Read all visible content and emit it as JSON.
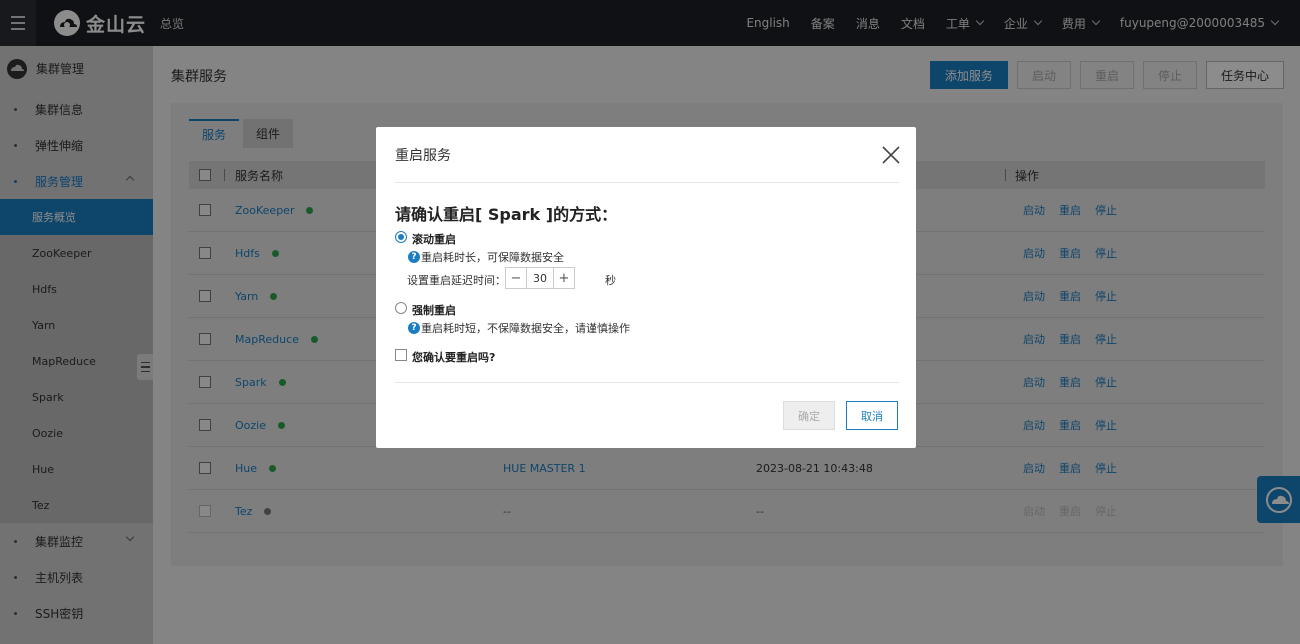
{
  "topbar": {
    "logo_text": "金山云",
    "overview": "总览",
    "nav": [
      {
        "label": "English",
        "dropdown": false
      },
      {
        "label": "备案",
        "dropdown": false
      },
      {
        "label": "消息",
        "dropdown": false
      },
      {
        "label": "文档",
        "dropdown": false
      },
      {
        "label": "工单",
        "dropdown": true
      },
      {
        "label": "企业",
        "dropdown": true
      },
      {
        "label": "费用",
        "dropdown": true
      },
      {
        "label": "fuyupeng@2000003485",
        "dropdown": true
      }
    ]
  },
  "sidebar": {
    "header": "集群管理",
    "items": [
      {
        "label": "集群信息"
      },
      {
        "label": "弹性伸缩"
      },
      {
        "label": "服务管理"
      },
      {
        "label": "集群监控"
      },
      {
        "label": "主机列表"
      },
      {
        "label": "SSH密钥"
      }
    ],
    "sub_items": [
      {
        "label": "服务概览"
      },
      {
        "label": "ZooKeeper"
      },
      {
        "label": "Hdfs"
      },
      {
        "label": "Yarn"
      },
      {
        "label": "MapReduce"
      },
      {
        "label": "Spark"
      },
      {
        "label": "Oozie"
      },
      {
        "label": "Hue"
      },
      {
        "label": "Tez"
      }
    ]
  },
  "main": {
    "title": "集群服务",
    "buttons": {
      "add": "添加服务",
      "start": "启动",
      "restart": "重启",
      "stop": "停止",
      "tasks": "任务中心"
    },
    "tabs": [
      {
        "label": "服务"
      },
      {
        "label": "组件"
      }
    ],
    "table": {
      "col_name": "服务名称",
      "col_ops": "操作",
      "ops_labels": {
        "start": "启动",
        "restart": "重启",
        "stop": "停止"
      },
      "rows": [
        {
          "name": "ZooKeeper",
          "status_color": "#2ea44f",
          "col3": "",
          "col4": ""
        },
        {
          "name": "Hdfs",
          "status_color": "#2ea44f",
          "col3": "",
          "col4": ""
        },
        {
          "name": "Yarn",
          "status_color": "#2ea44f",
          "col3": "",
          "col4": ""
        },
        {
          "name": "MapReduce",
          "status_color": "#2ea44f",
          "col3": "",
          "col4": ""
        },
        {
          "name": "Spark",
          "status_color": "#2ea44f",
          "col3": "",
          "col4": ""
        },
        {
          "name": "Oozie",
          "status_color": "#2ea44f",
          "col3": "",
          "col4": ""
        },
        {
          "name": "Hue",
          "status_color": "#2ea44f",
          "col3": "HUE MASTER 1",
          "col4": "2023-08-21 10:43:48"
        },
        {
          "name": "Tez",
          "status_color": "#777777",
          "col3": "--",
          "col4": "--"
        }
      ]
    }
  },
  "modal": {
    "title": "重启服务",
    "question": "请确认重启[ Spark ]的方式：",
    "option_rolling": {
      "label": "滚动重启",
      "hint": "重启耗时长，可保障数据安全",
      "selected": true
    },
    "delay": {
      "label": "设置重启延迟时间：",
      "value": "30",
      "unit": "秒",
      "minus": "−",
      "plus": "+"
    },
    "option_force": {
      "label": "强制重启",
      "hint": "重启耗时短，不保障数据安全，请谨慎操作",
      "selected": false
    },
    "confirm_check": "您确认要重启吗?",
    "ok": "确定",
    "cancel": "取消"
  },
  "colors": {
    "accent": "#1b7ec3",
    "topbar": "#1e2026",
    "status_ok": "#2ea44f",
    "status_off": "#777777"
  }
}
